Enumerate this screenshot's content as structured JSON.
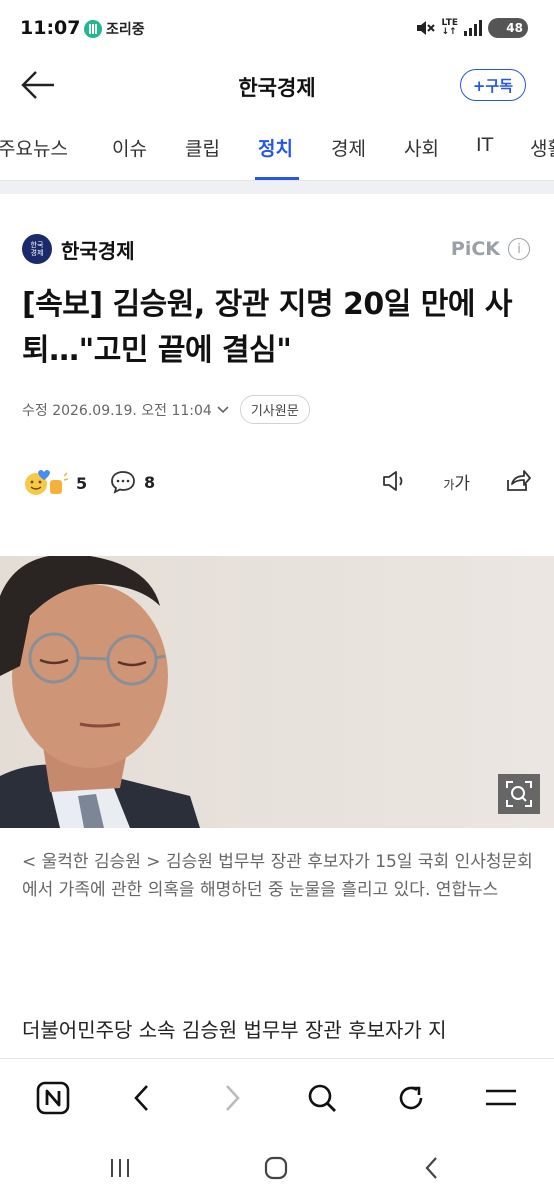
{
  "status_bar": {
    "time": "11:07",
    "cooking_label": "조리중",
    "network": "LTE",
    "battery": "48"
  },
  "header": {
    "title": "한국경제",
    "subscribe_label": "+구독"
  },
  "tabs": [
    "주요뉴스",
    "이슈",
    "클립",
    "정치",
    "경제",
    "사회",
    "IT",
    "생활"
  ],
  "active_tab": "정치",
  "article": {
    "publisher": "한국경제",
    "publisher_logo_text": "한국\n경제",
    "pick_label": "PiCK",
    "headline": "[속보] 김승원, 장관 지명 20일 만에 사퇴…\"고민 끝에 결심\"",
    "date": "수정 2026.09.19. 오전 11:04",
    "original_label": "기사원문",
    "reaction_count": "5",
    "comment_count": "8",
    "font_size_label": "가가",
    "caption": "< 울컥한 김승원 > 김승원 법무부 장관 후보자가 15일 국회 인사청문회에서 가족에 관한 의혹을 해명하던 중 눈물을 흘리고 있다. 연합뉴스",
    "body_first_line": "더불어민주당 소속 김승원 법무부 장관 후보자가 지"
  },
  "colors": {
    "accent": "#2457e6",
    "muted": "#9aa0a8"
  }
}
